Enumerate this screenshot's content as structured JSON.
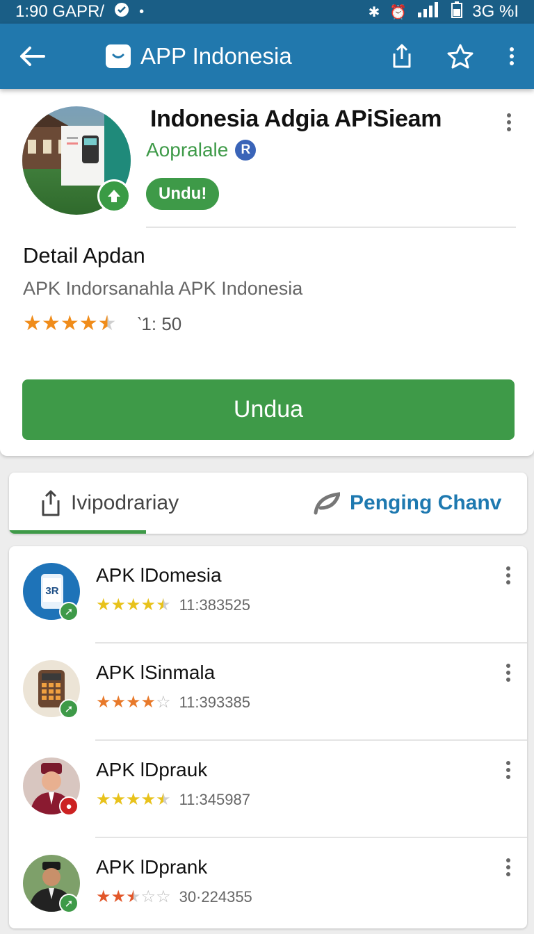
{
  "status_bar": {
    "time": "1:90 GAPR/",
    "battery": "3G %I"
  },
  "app_bar": {
    "title": "APP Indonesia"
  },
  "app": {
    "name": "Indonesia Adgia APiSieam",
    "developer": "Aopralale",
    "verified_badge": "R",
    "small_button_label": "Undu!",
    "detail_title": "Detail Apdan",
    "detail_subtitle": "APK Indorsanahla APK Indonesia",
    "rating": 4.5,
    "rating_text": "‵1: 50",
    "install_label": "Undua"
  },
  "tabs": [
    {
      "label": "Ivipodrariay",
      "icon": "share-icon"
    },
    {
      "label": "Penging Chanv",
      "icon": "leaf-icon"
    }
  ],
  "list": [
    {
      "name": "APK lDomesia",
      "count": "11:383525",
      "rating": 4.5,
      "star_color": "#e8c21b",
      "icon": "phone-icon",
      "icon_text": "3R",
      "badge_color": "#3e9a48"
    },
    {
      "name": "APK lSinmala",
      "count": "11:393385",
      "rating": 4,
      "star_color": "#e8792a",
      "icon": "calculator-icon",
      "icon_text": "",
      "badge_color": "#3e9a48"
    },
    {
      "name": "APK lDprauk",
      "count": "11:345987",
      "rating": 4.5,
      "star_color": "#e8c21b",
      "icon": "person-icon",
      "icon_text": "",
      "badge_color": "#cc2222"
    },
    {
      "name": "APK lDprank",
      "count": "30·224355",
      "rating": 2.5,
      "star_color": "#e2572a",
      "icon": "person-icon",
      "icon_text": "",
      "badge_color": "#3e9a48"
    }
  ],
  "colors": {
    "app_bar": "#2178ad",
    "status_bar": "#1a5e86",
    "accent_green": "#3e9a48",
    "tab_blue": "#1e79b0",
    "star_orange": "#f08c1a"
  }
}
